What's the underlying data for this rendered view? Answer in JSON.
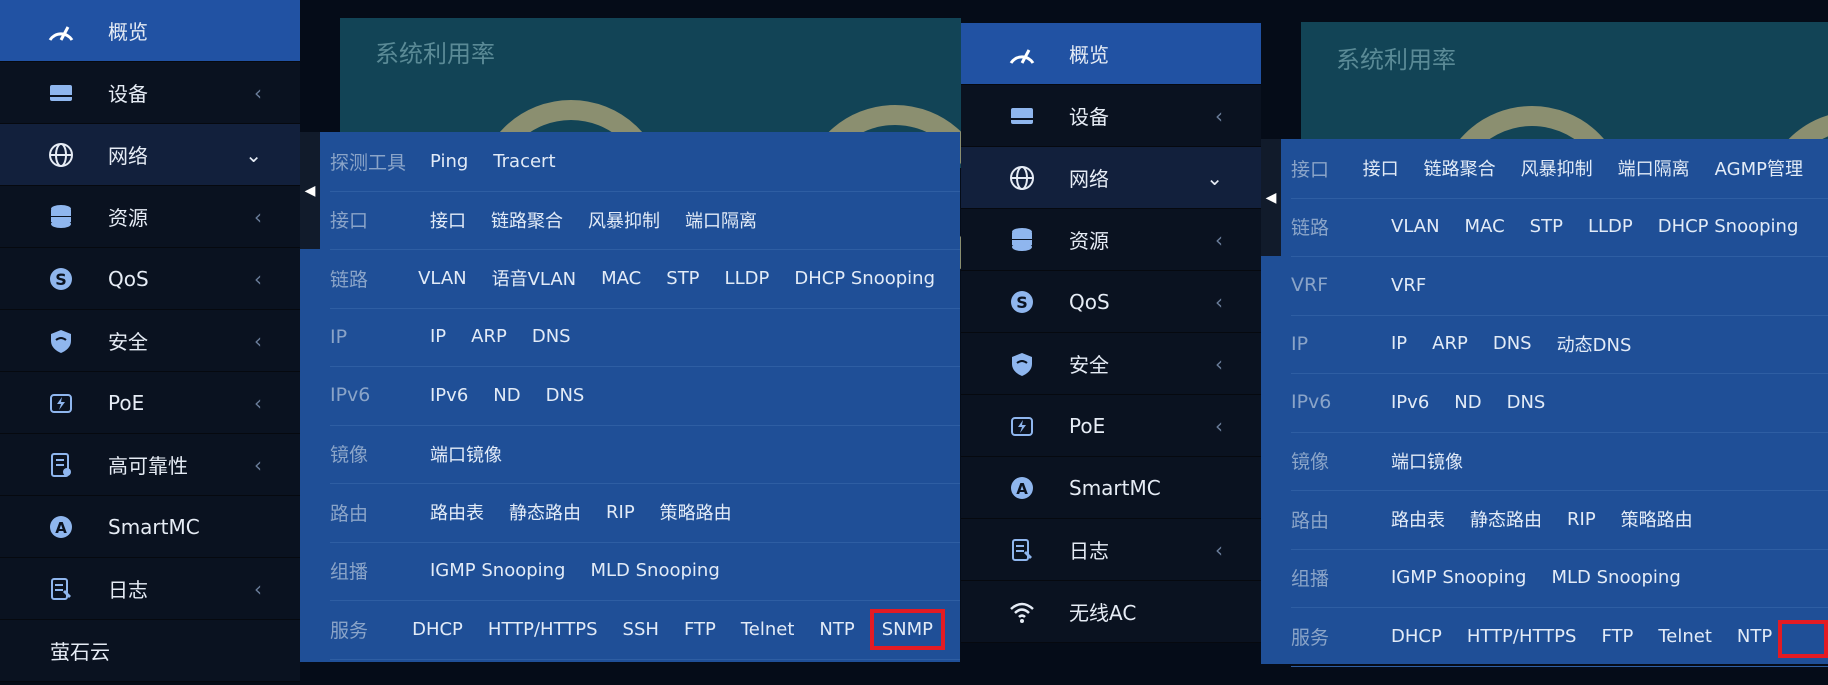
{
  "colors": {
    "accent": "#2152a3",
    "flyout_bg": "#1f4f97",
    "highlight": "#e31b23",
    "sidebar_bg": "#0a1220"
  },
  "left": {
    "card_title": "系统利用率",
    "sidebar": [
      {
        "label": "概览",
        "icon": "speedometer-icon",
        "state": "active",
        "chev": ""
      },
      {
        "label": "设备",
        "icon": "device-icon",
        "state": "",
        "chev": "‹"
      },
      {
        "label": "网络",
        "icon": "globe-icon",
        "state": "open",
        "chev": "⌄"
      },
      {
        "label": "资源",
        "icon": "database-icon",
        "state": "",
        "chev": "‹"
      },
      {
        "label": "QoS",
        "icon": "qos-icon",
        "state": "",
        "chev": "‹"
      },
      {
        "label": "安全",
        "icon": "shield-icon",
        "state": "",
        "chev": "‹"
      },
      {
        "label": "PoE",
        "icon": "poe-icon",
        "state": "",
        "chev": "‹"
      },
      {
        "label": "高可靠性",
        "icon": "reliability-icon",
        "state": "",
        "chev": "‹"
      },
      {
        "label": "SmartMC",
        "icon": "smartmc-icon",
        "state": "",
        "chev": ""
      },
      {
        "label": "日志",
        "icon": "log-icon",
        "state": "",
        "chev": "‹"
      },
      {
        "label": "萤石云",
        "icon": "",
        "state": "plain",
        "chev": ""
      }
    ],
    "flyout": [
      {
        "category": "探测工具",
        "links": [
          "Ping",
          "Tracert"
        ]
      },
      {
        "category": "接口",
        "links": [
          "接口",
          "链路聚合",
          "风暴抑制",
          "端口隔离"
        ]
      },
      {
        "category": "链路",
        "links": [
          "VLAN",
          "语音VLAN",
          "MAC",
          "STP",
          "LLDP",
          "DHCP Snooping"
        ]
      },
      {
        "category": "IP",
        "links": [
          "IP",
          "ARP",
          "DNS"
        ]
      },
      {
        "category": "IPv6",
        "links": [
          "IPv6",
          "ND",
          "DNS"
        ]
      },
      {
        "category": "镜像",
        "links": [
          "端口镜像"
        ]
      },
      {
        "category": "路由",
        "links": [
          "路由表",
          "静态路由",
          "RIP",
          "策略路由"
        ]
      },
      {
        "category": "组播",
        "links": [
          "IGMP Snooping",
          "MLD Snooping"
        ]
      },
      {
        "category": "服务",
        "links": [
          "DHCP",
          "HTTP/HTTPS",
          "SSH",
          "FTP",
          "Telnet",
          "NTP",
          "SNMP"
        ],
        "highlight": "SNMP"
      }
    ]
  },
  "right": {
    "card_title": "系统利用率",
    "sidebar": [
      {
        "label": "概览",
        "icon": "speedometer-icon",
        "state": "active",
        "chev": ""
      },
      {
        "label": "设备",
        "icon": "device-icon",
        "state": "",
        "chev": "‹"
      },
      {
        "label": "网络",
        "icon": "globe-icon",
        "state": "open",
        "chev": "⌄"
      },
      {
        "label": "资源",
        "icon": "database-icon",
        "state": "",
        "chev": "‹"
      },
      {
        "label": "QoS",
        "icon": "qos-icon",
        "state": "",
        "chev": "‹"
      },
      {
        "label": "安全",
        "icon": "shield-icon",
        "state": "",
        "chev": "‹"
      },
      {
        "label": "PoE",
        "icon": "poe-icon",
        "state": "",
        "chev": "‹"
      },
      {
        "label": "SmartMC",
        "icon": "smartmc-icon",
        "state": "",
        "chev": ""
      },
      {
        "label": "日志",
        "icon": "log-icon",
        "state": "",
        "chev": "‹"
      },
      {
        "label": "无线AC",
        "icon": "wifi-icon",
        "state": "",
        "chev": ""
      }
    ],
    "flyout": [
      {
        "category": "接口",
        "links": [
          "接口",
          "链路聚合",
          "风暴抑制",
          "端口隔离",
          "AGMP管理"
        ]
      },
      {
        "category": "链路",
        "links": [
          "VLAN",
          "MAC",
          "STP",
          "LLDP",
          "DHCP Snooping"
        ]
      },
      {
        "category": "VRF",
        "links": [
          "VRF"
        ]
      },
      {
        "category": "IP",
        "links": [
          "IP",
          "ARP",
          "DNS",
          "动态DNS"
        ]
      },
      {
        "category": "IPv6",
        "links": [
          "IPv6",
          "ND",
          "DNS"
        ]
      },
      {
        "category": "镜像",
        "links": [
          "端口镜像"
        ]
      },
      {
        "category": "路由",
        "links": [
          "路由表",
          "静态路由",
          "RIP",
          "策略路由"
        ]
      },
      {
        "category": "组播",
        "links": [
          "IGMP Snooping",
          "MLD Snooping"
        ]
      },
      {
        "category": "服务",
        "links": [
          "DHCP",
          "HTTP/HTTPS",
          "FTP",
          "Telnet",
          "NTP"
        ]
      }
    ]
  }
}
